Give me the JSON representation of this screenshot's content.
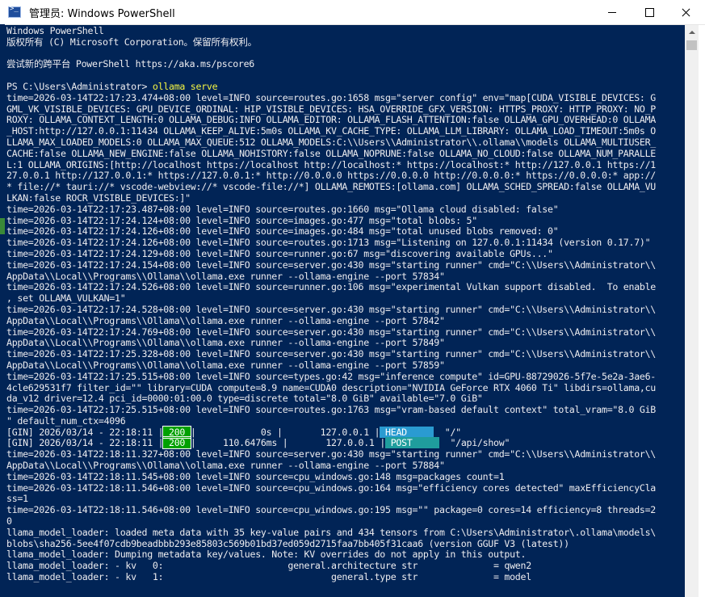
{
  "window": {
    "title": "管理员: Windows PowerShell",
    "icon": "powershell-icon"
  },
  "console": {
    "lines": [
      {
        "text": "Windows PowerShell"
      },
      {
        "text": "版权所有 (C) Microsoft Corporation。保留所有权利。"
      },
      {
        "text": ""
      },
      {
        "text": "尝试新的跨平台 PowerShell https://aka.ms/pscore6"
      },
      {
        "text": ""
      },
      {
        "prompt": "PS C:\\Users\\Administrator> ",
        "command": "ollama serve"
      },
      {
        "text": "time=2026-03-14T22:17:23.474+08:00 level=INFO source=routes.go:1658 msg=\"server config\" env=\"map[CUDA_VISIBLE_DEVICES: G"
      },
      {
        "text": "GML_VK_VISIBLE_DEVICES: GPU_DEVICE_ORDINAL: HIP_VISIBLE_DEVICES: HSA_OVERRIDE_GFX_VERSION: HTTPS_PROXY: HTTP_PROXY: NO_P"
      },
      {
        "text": "ROXY: OLLAMA_CONTEXT_LENGTH:0 OLLAMA_DEBUG:INFO OLLAMA_EDITOR: OLLAMA_FLASH_ATTENTION:false OLLAMA_GPU_OVERHEAD:0 OLLAMA"
      },
      {
        "text": "_HOST:http://127.0.0.1:11434 OLLAMA_KEEP_ALIVE:5m0s OLLAMA_KV_CACHE_TYPE: OLLAMA_LLM_LIBRARY: OLLAMA_LOAD_TIMEOUT:5m0s O"
      },
      {
        "text": "LLAMA_MAX_LOADED_MODELS:0 OLLAMA_MAX_QUEUE:512 OLLAMA_MODELS:C:\\\\Users\\\\Administrator\\\\.ollama\\\\models OLLAMA_MULTIUSER_"
      },
      {
        "text": "CACHE:false OLLAMA_NEW_ENGINE:false OLLAMA_NOHISTORY:false OLLAMA_NOPRUNE:false OLLAMA_NO_CLOUD:false OLLAMA_NUM_PARALLE"
      },
      {
        "text": "L:1 OLLAMA_ORIGINS:[http://localhost https://localhost http://localhost:* https://localhost:* http://127.0.0.1 https://1"
      },
      {
        "text": "27.0.0.1 http://127.0.0.1:* https://127.0.0.1:* http://0.0.0.0 https://0.0.0.0 http://0.0.0.0:* https://0.0.0.0:* app://"
      },
      {
        "text": "* file://* tauri://* vscode-webview://* vscode-file://*] OLLAMA_REMOTES:[ollama.com] OLLAMA_SCHED_SPREAD:false OLLAMA_VU"
      },
      {
        "text": "LKAN:false ROCR_VISIBLE_DEVICES:]\""
      },
      {
        "text": "time=2026-03-14T22:17:23.487+08:00 level=INFO source=routes.go:1660 msg=\"Ollama cloud disabled: false\""
      },
      {
        "text": "time=2026-03-14T22:17:24.124+08:00 level=INFO source=images.go:477 msg=\"total blobs: 5\""
      },
      {
        "text": "time=2026-03-14T22:17:24.126+08:00 level=INFO source=images.go:484 msg=\"total unused blobs removed: 0\""
      },
      {
        "text": "time=2026-03-14T22:17:24.126+08:00 level=INFO source=routes.go:1713 msg=\"Listening on 127.0.0.1:11434 (version 0.17.7)\""
      },
      {
        "text": "time=2026-03-14T22:17:24.129+08:00 level=INFO source=runner.go:67 msg=\"discovering available GPUs...\""
      },
      {
        "text": "time=2026-03-14T22:17:24.154+08:00 level=INFO source=server.go:430 msg=\"starting runner\" cmd=\"C:\\\\Users\\\\Administrator\\\\"
      },
      {
        "text": "AppData\\\\Local\\\\Programs\\\\Ollama\\\\ollama.exe runner --ollama-engine --port 57834\""
      },
      {
        "text": "time=2026-03-14T22:17:24.526+08:00 level=INFO source=runner.go:106 msg=\"experimental Vulkan support disabled.  To enable"
      },
      {
        "text": ", set OLLAMA_VULKAN=1\""
      },
      {
        "text": "time=2026-03-14T22:17:24.528+08:00 level=INFO source=server.go:430 msg=\"starting runner\" cmd=\"C:\\\\Users\\\\Administrator\\\\"
      },
      {
        "text": "AppData\\\\Local\\\\Programs\\\\Ollama\\\\ollama.exe runner --ollama-engine --port 57842\""
      },
      {
        "text": "time=2026-03-14T22:17:24.769+08:00 level=INFO source=server.go:430 msg=\"starting runner\" cmd=\"C:\\\\Users\\\\Administrator\\\\"
      },
      {
        "text": "AppData\\\\Local\\\\Programs\\\\Ollama\\\\ollama.exe runner --ollama-engine --port 57849\""
      },
      {
        "text": "time=2026-03-14T22:17:25.328+08:00 level=INFO source=server.go:430 msg=\"starting runner\" cmd=\"C:\\\\Users\\\\Administrator\\\\"
      },
      {
        "text": "AppData\\\\Local\\\\Programs\\\\Ollama\\\\ollama.exe runner --ollama-engine --port 57859\""
      },
      {
        "text": "time=2026-03-14T22:17:25.515+08:00 level=INFO source=types.go:42 msg=\"inference compute\" id=GPU-88729026-5f7e-5e2a-3ae6-"
      },
      {
        "text": "4cle629531f7 filter_id=\"\" library=CUDA compute=8.9 name=CUDA0 description=\"NVIDIA GeForce RTX 4060 Ti\" libdirs=ollama,cu"
      },
      {
        "text": "da_v12 driver=12.4 pci_id=0000:01:00.0 type=discrete total=\"8.0 GiB\" available=\"7.0 GiB\""
      },
      {
        "text": "time=2026-03-14T22:17:25.515+08:00 level=INFO source=routes.go:1763 msg=\"vram-based default context\" total_vram=\"8.0 GiB"
      },
      {
        "text": "\" default_num_ctx=4096"
      },
      {
        "gin": {
          "prefix": "[GIN] 2026/03/14 - 22:18:11 |",
          "status": " 200 ",
          "mid": "|            0s |       127.0.0.1 |",
          "method": " HEAD     ",
          "method_style": "badge-blue",
          "path": "  \"/\""
        }
      },
      {
        "gin": {
          "prefix": "[GIN] 2026/03/14 - 22:18:11 |",
          "status": " 200 ",
          "mid": "|     110.6476ms |       127.0.0.1 |",
          "method": " POST     ",
          "method_style": "badge-cyan",
          "path": "  \"/api/show\""
        }
      },
      {
        "text": "time=2026-03-14T22:18:11.327+08:00 level=INFO source=server.go:430 msg=\"starting runner\" cmd=\"C:\\\\Users\\\\Administrator\\\\"
      },
      {
        "text": "AppData\\\\Local\\\\Programs\\\\Ollama\\\\ollama.exe runner --ollama-engine --port 57884\""
      },
      {
        "text": "time=2026-03-14T22:18:11.545+08:00 level=INFO source=cpu_windows.go:148 msg=packages count=1"
      },
      {
        "text": "time=2026-03-14T22:18:11.546+08:00 level=INFO source=cpu_windows.go:164 msg=\"efficiency cores detected\" maxEfficiencyCla"
      },
      {
        "text": "ss=1"
      },
      {
        "text": "time=2026-03-14T22:18:11.546+08:00 level=INFO source=cpu_windows.go:195 msg=\"\" package=0 cores=14 efficiency=8 threads=2"
      },
      {
        "text": "0"
      },
      {
        "text": "llama_model_loader: loaded meta data with 35 key-value pairs and 434 tensors from C:\\Users\\Administrator\\.ollama\\models\\"
      },
      {
        "text": "blobs\\sha256-5ee4f07cdb9beadbbb293e85803c569b01bd37ed059d2715faa7bb405f31caa6 (version GGUF V3 (latest))"
      },
      {
        "text": "llama_model_loader: Dumping metadata key/values. Note: KV overrides do not apply in this output."
      },
      {
        "text": "llama_model_loader: - kv   0:                       general.architecture str              = qwen2"
      },
      {
        "text": "llama_model_loader: - kv   1:                               general.type str              = model"
      }
    ]
  },
  "colors": {
    "console_bg": "#012456",
    "console_fg": "#eeedf0",
    "command": "#f5f543",
    "status_200": "#00a000",
    "method_head": "#2a9bd1",
    "method_post": "#1f9d9d"
  },
  "controls": {
    "minimize": "minimize-icon",
    "maximize": "maximize-icon",
    "close": "close-icon"
  }
}
